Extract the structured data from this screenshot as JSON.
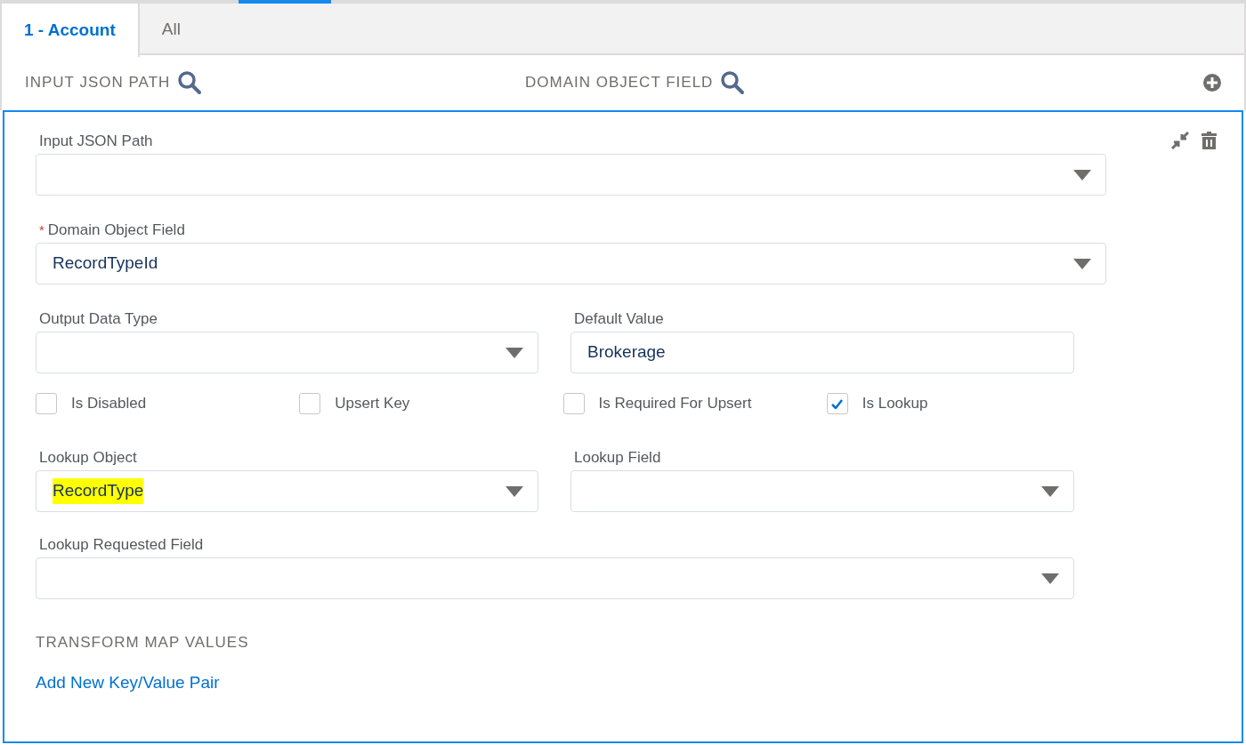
{
  "tabs": [
    {
      "label": "1 - Account",
      "selected": true
    },
    {
      "label": "All",
      "selected": false
    }
  ],
  "columns": [
    {
      "label": "INPUT JSON PATH"
    },
    {
      "label": "DOMAIN OBJECT FIELD"
    }
  ],
  "form": {
    "input_json_path": {
      "label": "Input JSON Path",
      "kind": "select"
    },
    "domain_object_field": {
      "label": "Domain Object Field",
      "required": true,
      "required_mark": "*",
      "value": "RecordTypeId",
      "kind": "select"
    },
    "output_data_type": {
      "label": "Output Data Type",
      "kind": "select"
    },
    "default_value": {
      "label": "Default Value",
      "value": "Brokerage",
      "kind": "text"
    },
    "options": [
      {
        "label": "Is Disabled",
        "checked": false
      },
      {
        "label": "Upsert Key",
        "checked": false
      },
      {
        "label": "Is Required For Upsert",
        "checked": false
      },
      {
        "label": "Is Lookup",
        "checked": true
      }
    ],
    "lookup_object": {
      "label": "Lookup Object",
      "value": "RecordType",
      "highlighted": true,
      "kind": "select"
    },
    "lookup_field": {
      "label": "Lookup Field",
      "kind": "select"
    },
    "lookup_requested_field": {
      "label": "Lookup Requested Field",
      "kind": "select"
    },
    "transform_title": "TRANSFORM MAP VALUES",
    "add_pair_link": "Add New Key/Value Pair"
  }
}
